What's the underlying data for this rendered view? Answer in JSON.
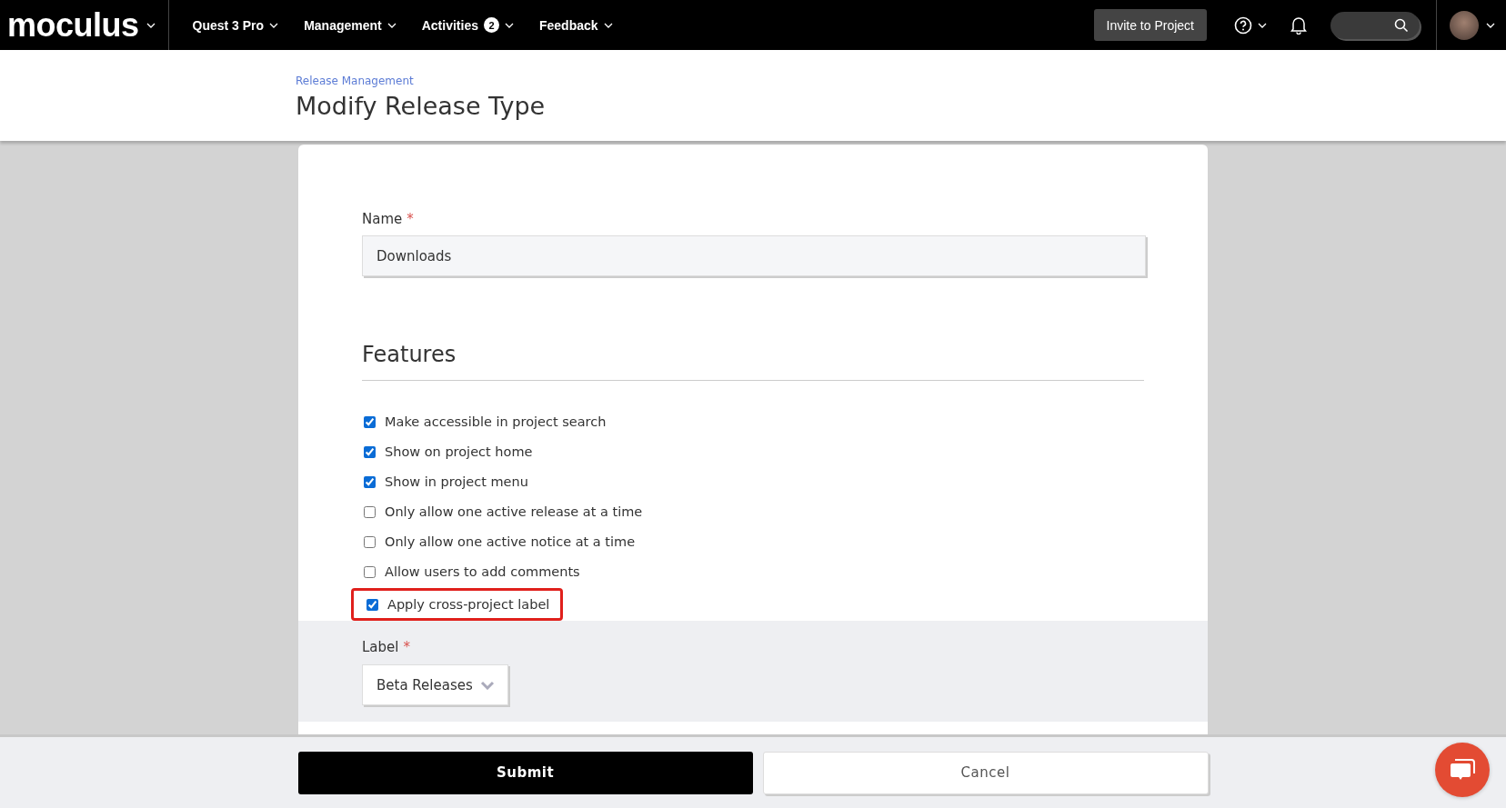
{
  "nav": {
    "logo": "moculus",
    "menus": [
      {
        "label": "Quest 3 Pro"
      },
      {
        "label": "Management"
      },
      {
        "label": "Activities",
        "badge": "2"
      },
      {
        "label": "Feedback"
      }
    ],
    "invite_button": "Invite to Project"
  },
  "header": {
    "breadcrumb": "Release Management",
    "title": "Modify Release Type"
  },
  "form": {
    "name_label": "Name",
    "name_required_mark": "*",
    "name_value": "Downloads",
    "features_title": "Features",
    "features": [
      {
        "label": "Make accessible in project search",
        "checked": true,
        "highlighted": false
      },
      {
        "label": "Show on project home",
        "checked": true,
        "highlighted": false
      },
      {
        "label": "Show in project menu",
        "checked": true,
        "highlighted": false
      },
      {
        "label": "Only allow one active release at a time",
        "checked": false,
        "highlighted": false
      },
      {
        "label": "Only allow one active notice at a time",
        "checked": false,
        "highlighted": false
      },
      {
        "label": "Allow users to add comments",
        "checked": false,
        "highlighted": false
      },
      {
        "label": "Apply cross-project label",
        "checked": true,
        "highlighted": true
      }
    ],
    "label_label": "Label",
    "label_required_mark": "*",
    "label_value": "Beta Releases"
  },
  "footer": {
    "submit": "Submit",
    "cancel": "Cancel"
  }
}
